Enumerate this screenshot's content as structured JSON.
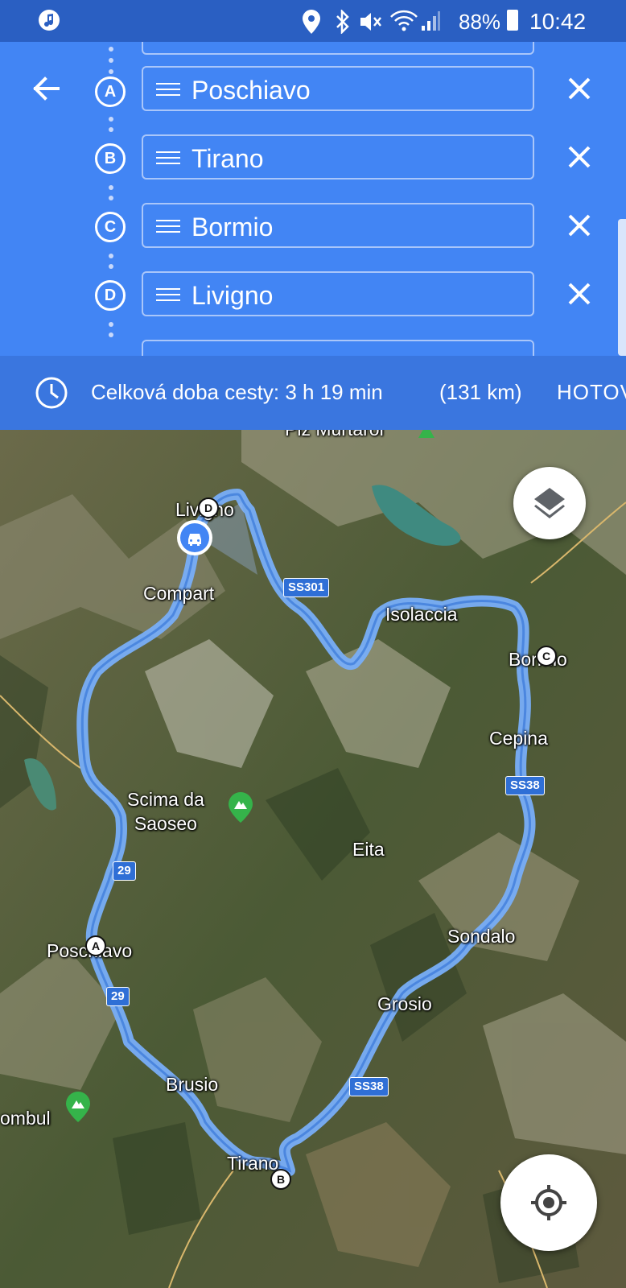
{
  "status_bar": {
    "battery": "88%",
    "time": "10:42",
    "icons": [
      "music-note-icon",
      "location-icon",
      "bluetooth-icon",
      "mute-icon",
      "wifi-icon",
      "signal-icon",
      "battery-icon"
    ]
  },
  "header": {
    "back_icon": "arrow-left-icon",
    "stops": [
      {
        "letter": "A",
        "name": "Poschiavo"
      },
      {
        "letter": "B",
        "name": "Tirano"
      },
      {
        "letter": "C",
        "name": "Bormio"
      },
      {
        "letter": "D",
        "name": "Livigno"
      }
    ]
  },
  "summary": {
    "total_time_label": "Celková doba cesty: 3 h 19 min",
    "distance": "(131 km)",
    "done_label": "HOTOVO"
  },
  "map": {
    "labels": [
      {
        "key": "piz",
        "text": "Piz Murtarol"
      },
      {
        "key": "livigno",
        "text": "Livigno"
      },
      {
        "key": "compart",
        "text": "Compart"
      },
      {
        "key": "isolaccia",
        "text": "Isolaccia"
      },
      {
        "key": "bormio",
        "text": "Bormio"
      },
      {
        "key": "cepina",
        "text": "Cepina"
      },
      {
        "key": "scima",
        "text": "Scima da\nSaoseo"
      },
      {
        "key": "eita",
        "text": "Eita"
      },
      {
        "key": "poschiavo",
        "text": "Poschiavo"
      },
      {
        "key": "sondalo",
        "text": "Sondalo"
      },
      {
        "key": "grosio",
        "text": "Grosio"
      },
      {
        "key": "brusio",
        "text": "Brusio"
      },
      {
        "key": "tirano",
        "text": "Tirano"
      },
      {
        "key": "combul",
        "text": "ombul"
      }
    ],
    "road_shields": [
      "SS301",
      "SS38",
      "29",
      "29",
      "SS38"
    ],
    "waypoints": [
      "A",
      "B",
      "C",
      "D"
    ],
    "route_color": "#78aef8"
  }
}
